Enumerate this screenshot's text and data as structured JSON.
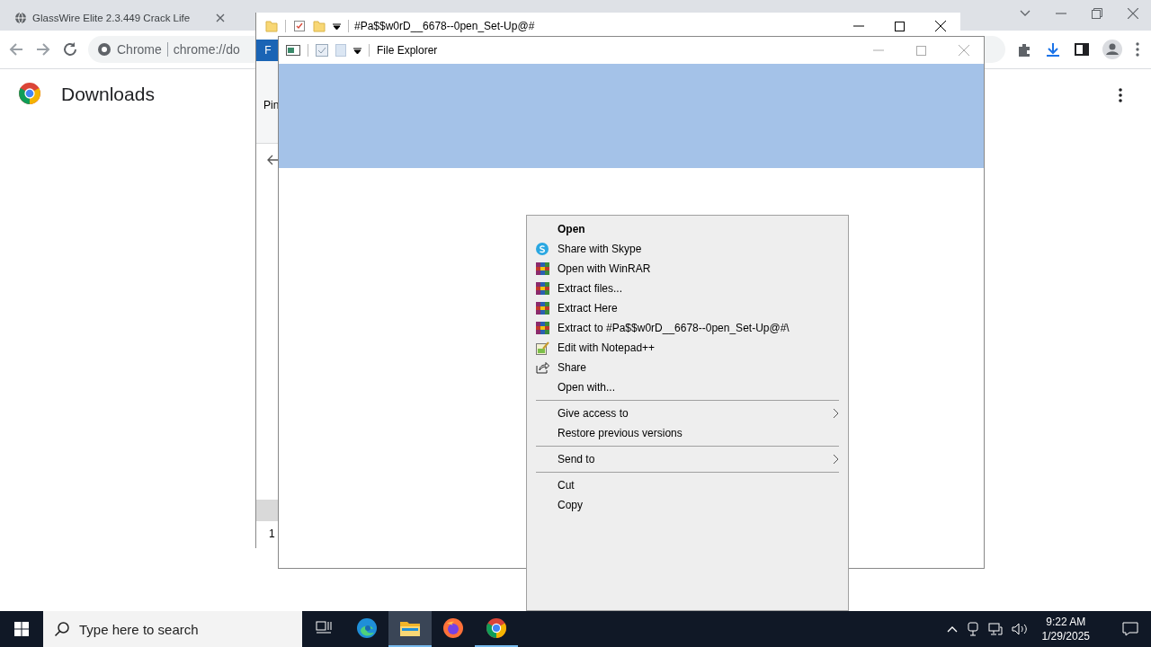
{
  "browser": {
    "tabs": [
      {
        "title": "GlassWire Elite 2.3.449 Crack Life",
        "selected": false
      }
    ],
    "omnibox": {
      "site": "Chrome",
      "url": "chrome://do"
    },
    "page": {
      "title": "Downloads"
    }
  },
  "back_window": {
    "title": "#Pa$$w0rD__6678--0pen_Set-Up@#",
    "ribbon_tab": "F",
    "ribbon_label": "Pin",
    "status": "1"
  },
  "front_window": {
    "title": "File Explorer"
  },
  "context_menu": {
    "items": [
      {
        "kind": "default",
        "label": "Open"
      },
      {
        "kind": "skype",
        "label": "Share with Skype"
      },
      {
        "kind": "winrar",
        "label": "Open with WinRAR"
      },
      {
        "kind": "winrar",
        "label": "Extract files..."
      },
      {
        "kind": "winrar",
        "label": "Extract Here"
      },
      {
        "kind": "winrar",
        "label": "Extract to #Pa$$w0rD__6678--0pen_Set-Up@#\\"
      },
      {
        "kind": "notepad",
        "label": "Edit with Notepad++"
      },
      {
        "kind": "share",
        "label": "Share"
      },
      {
        "kind": "plain",
        "label": "Open with..."
      },
      {
        "kind": "separator"
      },
      {
        "kind": "submenu",
        "label": "Give access to"
      },
      {
        "kind": "plain",
        "label": "Restore previous versions"
      },
      {
        "kind": "separator"
      },
      {
        "kind": "submenu",
        "label": "Send to"
      },
      {
        "kind": "separator"
      },
      {
        "kind": "plain",
        "label": "Cut"
      },
      {
        "kind": "plain",
        "label": "Copy"
      }
    ]
  },
  "taskbar": {
    "search_placeholder": "Type here to search",
    "apps": [
      {
        "kind": "task-view",
        "selected": false,
        "running": false
      },
      {
        "kind": "edge",
        "selected": false,
        "running": false
      },
      {
        "kind": "explorer",
        "selected": true,
        "running": true
      },
      {
        "kind": "firefox",
        "selected": false,
        "running": false
      },
      {
        "kind": "chrome",
        "selected": false,
        "running": true
      }
    ],
    "time": "9:22 AM",
    "date": "1/29/2025"
  }
}
